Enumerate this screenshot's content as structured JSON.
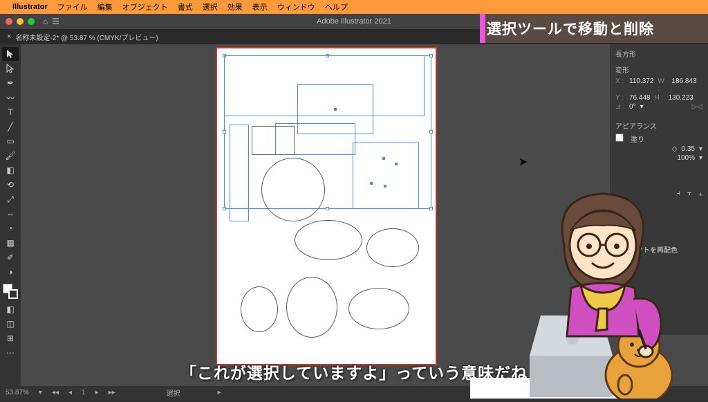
{
  "mac_menu": {
    "app": "Illustrator",
    "items": [
      "ファイル",
      "編集",
      "オブジェクト",
      "書式",
      "選択",
      "効果",
      "表示",
      "ウィンドウ",
      "ヘルプ"
    ]
  },
  "window_title": "Adobe Illustrator 2021",
  "document_tab": "名称未設定-2* @ 53.87 % (CMYK/プレビュー)",
  "lesson_title": "選択ツールで移動と削除",
  "subtitle": "「これが選択していますよ」っていう意味だね",
  "properties": {
    "header1": "長方形",
    "header2": "変形",
    "x_label": "X :",
    "x_val": "110.372",
    "w_label": "W :",
    "w_val": "186.843",
    "y_label": "Y :",
    "y_val": "76.448",
    "h_label": "H :",
    "h_val": "130.223",
    "angle_label": "⊿ :",
    "angle_val": "0°",
    "appearance_hd": "アピアランス",
    "fill_label": "塗り",
    "opacity_val": "0.35",
    "opacity2_val": "100%",
    "corner_hd": "ープ",
    "recolor": "ブジェクトを再配色"
  },
  "status": {
    "zoom": "53.87%",
    "nav": "1",
    "mode": "選択"
  }
}
